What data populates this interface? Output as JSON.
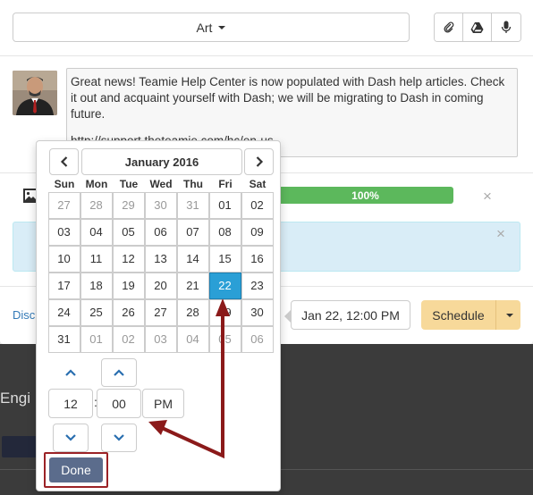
{
  "header": {
    "category_value": "Art",
    "attach_icons": [
      "paperclip-icon",
      "google-drive-icon",
      "microphone-icon"
    ]
  },
  "post": {
    "message": "Great news! Teamie Help Center is now populated with Dash help articles. Check it out and acquaint yourself with Dash; we will be migrating to Dash in coming future.",
    "link": "http://support.theteamie.com/hc/en-us"
  },
  "upload": {
    "progress_label": "100%",
    "progress_percent": 100
  },
  "footer": {
    "discard_label": "Disc",
    "date_value": "Jan 22, 12:00 PM",
    "schedule_label": "Schedule"
  },
  "datepicker": {
    "title": "January 2016",
    "weekdays": [
      "Sun",
      "Mon",
      "Tue",
      "Wed",
      "Thu",
      "Fri",
      "Sat"
    ],
    "weeks": [
      [
        "27",
        "28",
        "29",
        "30",
        "31",
        "01",
        "02"
      ],
      [
        "03",
        "04",
        "05",
        "06",
        "07",
        "08",
        "09"
      ],
      [
        "10",
        "11",
        "12",
        "13",
        "14",
        "15",
        "16"
      ],
      [
        "17",
        "18",
        "19",
        "20",
        "21",
        "22",
        "23"
      ],
      [
        "24",
        "25",
        "26",
        "27",
        "28",
        "29",
        "30"
      ],
      [
        "31",
        "01",
        "02",
        "03",
        "04",
        "05",
        "06"
      ]
    ],
    "muted": [
      [
        true,
        true,
        true,
        true,
        true,
        false,
        false
      ],
      [
        false,
        false,
        false,
        false,
        false,
        false,
        false
      ],
      [
        false,
        false,
        false,
        false,
        false,
        false,
        false
      ],
      [
        false,
        false,
        false,
        false,
        false,
        false,
        false
      ],
      [
        false,
        false,
        false,
        false,
        false,
        false,
        false
      ],
      [
        false,
        true,
        true,
        true,
        true,
        true,
        true
      ]
    ],
    "selected_day": "22",
    "hour": "12",
    "minute": "00",
    "meridian": "PM",
    "done_label": "Done"
  },
  "background": {
    "partial_text": "Engi"
  },
  "colors": {
    "accent": "#2a9fd6",
    "progress": "#5cb85c",
    "schedule": "#f7d99a",
    "done": "#5b6c8c",
    "annotation": "#8b1a1a"
  }
}
